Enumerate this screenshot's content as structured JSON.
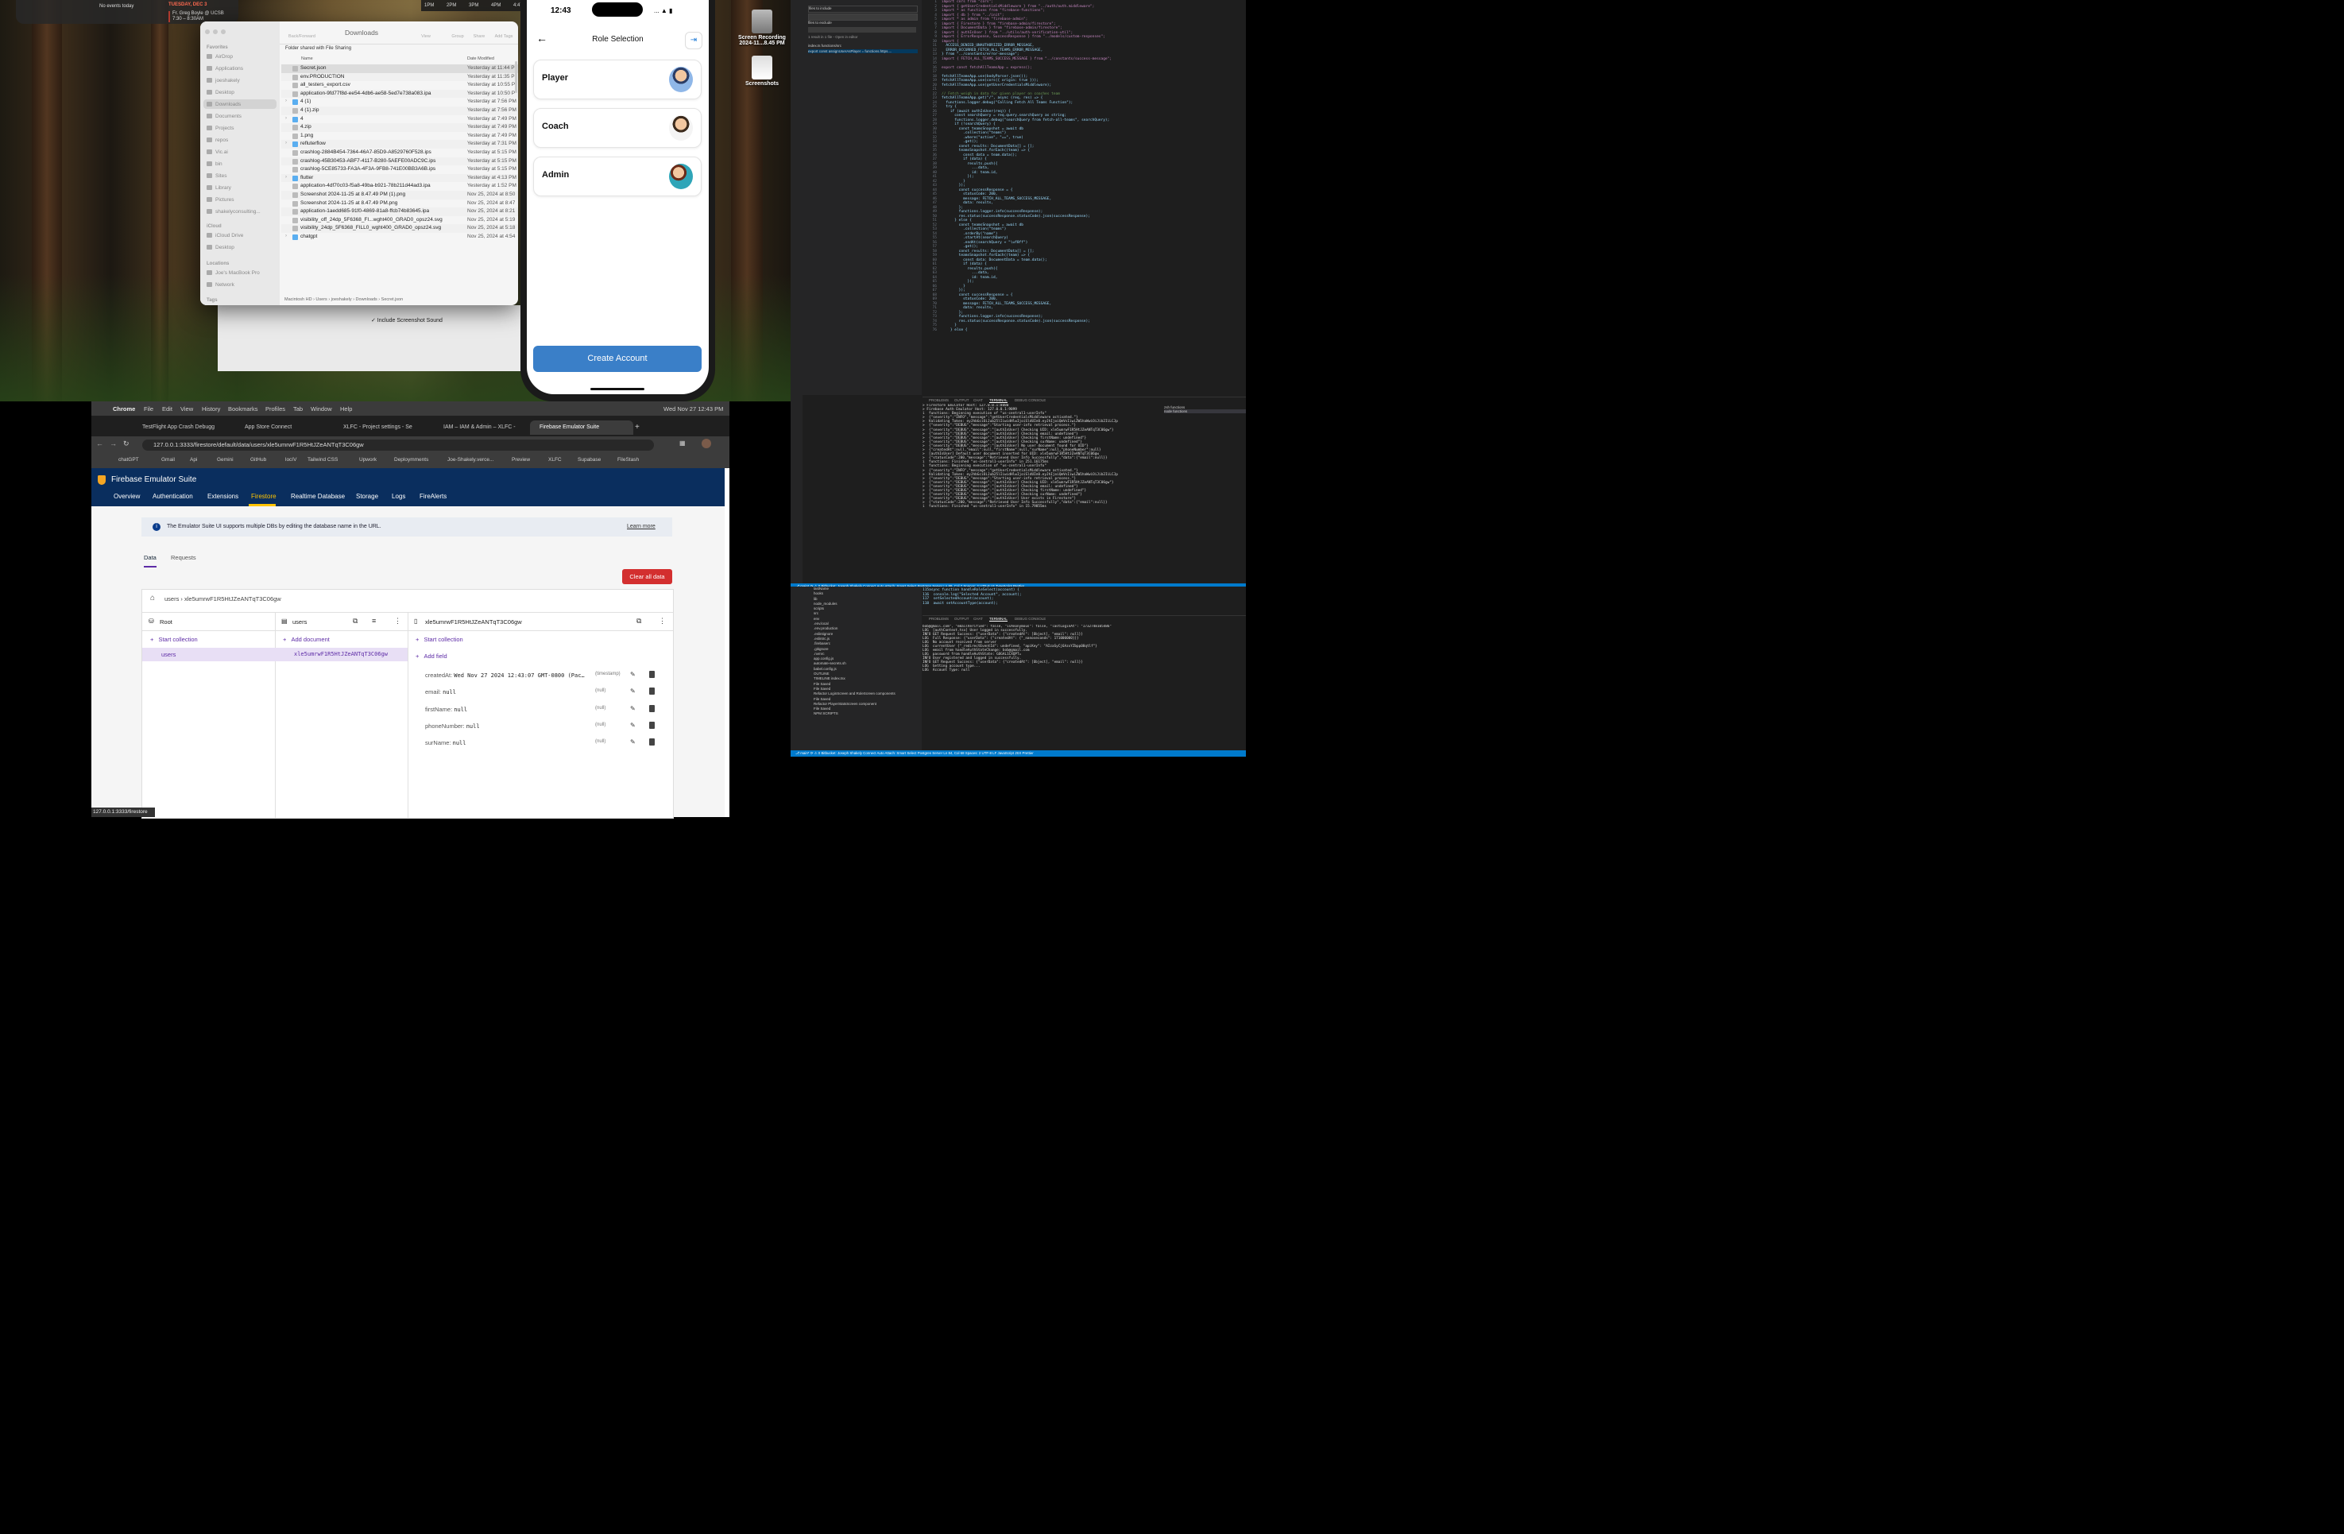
{
  "calendar_widget": {
    "no_events": "No events today",
    "date": "TUESDAY, DEC 3",
    "event_title": "Fr. Greg Boyle @ UCSB",
    "event_time": "7:30 – 8:30AM"
  },
  "timeline": {
    "labels": [
      "1PM",
      "2PM",
      "3PM",
      "4PM",
      "4:47"
    ]
  },
  "finder": {
    "title": "Downloads",
    "toolbar": {
      "back": "Back/Forward",
      "view": "View",
      "group": "Group",
      "share": "Share",
      "add_tags": "Add Tags"
    },
    "sidebar": {
      "favorites_header": "Favorites",
      "favorites": [
        "AirDrop",
        "Applications",
        "joeshakely",
        "Desktop",
        "Downloads",
        "Documents",
        "Projects",
        "repos",
        "Vic.ai",
        "bin",
        "Sites",
        "Library",
        "Pictures",
        "shakelyconsulting..."
      ],
      "icloud_header": "iCloud",
      "icloud": [
        "iCloud Drive",
        "Desktop"
      ],
      "locations_header": "Locations",
      "locations": [
        "Joe's MacBook Pro",
        "Network"
      ],
      "tags_header": "Tags"
    },
    "shared_label": "Folder shared with File Sharing",
    "columns": {
      "name": "Name",
      "modified": "Date Modified"
    },
    "files": [
      {
        "name": "Secret.json",
        "date": "Yesterday at 11:44 P"
      },
      {
        "name": "env.PRODUCTION",
        "date": "Yesterday at 11:35 P"
      },
      {
        "name": "all_testers_export.csv",
        "date": "Yesterday at 10:55 P"
      },
      {
        "name": "application-9fd77f8d-ee54-4db6-ae58-5ed7e738a083.ipa",
        "date": "Yesterday at 10:50 P"
      },
      {
        "name": "4 (1)",
        "date": "Yesterday at 7:56 PM"
      },
      {
        "name": "4 (1).zip",
        "date": "Yesterday at 7:56 PM"
      },
      {
        "name": "4",
        "date": "Yesterday at 7:49 PM"
      },
      {
        "name": "4.zip",
        "date": "Yesterday at 7:49 PM"
      },
      {
        "name": "1.png",
        "date": "Yesterday at 7:49 PM"
      },
      {
        "name": "refluterflow",
        "date": "Yesterday at 7:31 PM"
      },
      {
        "name": "crashlog-2884B454-7364-46A7-85D9-A8529760F528.ips",
        "date": "Yesterday at 5:15 PM"
      },
      {
        "name": "crashlog-45B30453-ABF7-4117-B280-5AEFE00ADC9C.ips",
        "date": "Yesterday at 5:15 PM"
      },
      {
        "name": "crashlog-5CE85733-FA3A-4F3A-9FB8-741E00BB3A6B.ips",
        "date": "Yesterday at 5:15 PM"
      },
      {
        "name": "flutter",
        "date": "Yesterday at 4:13 PM"
      },
      {
        "name": "application-4df70c03-f5a8-49ba-b921-78b211d44ad3.ipa",
        "date": "Yesterday at 1:52 PM"
      },
      {
        "name": "Screenshot 2024-11-25 at 8.47.49 PM (1).png",
        "date": "Nov 25, 2024 at 8:50"
      },
      {
        "name": "Screenshot 2024-11-25 at 8.47.49 PM.png",
        "date": "Nov 25, 2024 at 8:47"
      },
      {
        "name": "application-1aedd685-91f0-4869-81a8-ffcb74b83645.ipa",
        "date": "Nov 25, 2024 at 8:21"
      },
      {
        "name": "visibility_off_24dp_5F6368_FI...wght400_GRAD0_opsz24.svg",
        "date": "Nov 25, 2024 at 5:19"
      },
      {
        "name": "visibility_24dp_5F6368_FILL0_wght400_GRAD0_opsz24.svg",
        "date": "Nov 25, 2024 at 5:18"
      },
      {
        "name": "chatgpt",
        "date": "Nov 25, 2024 at 4:54"
      }
    ],
    "path": "Macintosh HD › Users › joeshakely › Downloads › Secret.json"
  },
  "screenshot_panel": {
    "checkbox": "✓ Include Screenshot Sound"
  },
  "desktop_icons": {
    "recording": "Screen Recording 2024-11...8.45 PM",
    "screenshots": "Screenshots"
  },
  "phone": {
    "time": "12:43",
    "status": "... ▲ ▮",
    "title": "Role Selection",
    "roles": [
      "Player",
      "Coach",
      "Admin"
    ],
    "cta": "Create Account"
  },
  "vscode": {
    "search": {
      "include": "files to include",
      "exclude": "files to exclude",
      "result": "1 result in 1 file - Open in editor",
      "file": "index.ts functions/src",
      "match": "export const assignUserAsPlayer = functions.https...."
    },
    "code_lines": [
      "import cors from \"cors\";",
      "import { getUserCredentialsMiddleware } from \"../auth/auth.middleware\";",
      "import * as functions from \"firebase-functions\";",
      "import { db } from \"../init\";",
      "import * as admin from \"firebase-admin\";",
      "import { Firestore } from \"firebase-admin/firestore\";",
      "import { DocumentData } from \"firebase-admin/firestore\";",
      "import { authIsUser } from \"../utils/auth-verification-util\";",
      "import { ErrorResponse, SuccessResponse } from \"../models/custom-responses\";",
      "import {",
      "  ACCESS_DENIED_UNAUTHORIZED_ERROR_MESSAGE,",
      "  ERROR_OCCURRED_FETCH_ALL_TEAMS_ERROR_MESSAGE,",
      "} from \"../constants/error-message\";",
      "import { FETCH_ALL_TEAMS_SUCCESS_MESSAGE } from \"../constants/success-message\";",
      "",
      "export const fetchAllTeamsApp = express();",
      "",
      "fetchAllTeamsApp.use(bodyParser.json());",
      "fetchAllTeamsApp.use(cors({ origin: true }));",
      "fetchAllTeamsApp.use(getUserCredentialsMiddleware);",
      "",
      "// Fetch weigh in data for given player on coaches team",
      "fetchAllTeamsApp.get(\"/\", async (req, res) => {",
      "  functions.logger.debug(\"Calling Fetch All Teams Function\");",
      "  try {",
      "    if (await authIsUser(req)) {",
      "      const searchQuery = req.query.searchQuery as string;",
      "      functions.logger.debug(\"searchQuery from fetch-all-teams\", searchQuery);",
      "      if (!searchQuery) {",
      "        const teamsSnapshot = await db",
      "          .collection(\"teams\")",
      "          .where(\"active\", \"==\", true)",
      "          .get();",
      "        const results: DocumentData[] = [];",
      "        teamsSnapshot.forEach((team) => {",
      "          const data = team.data();",
      "          if (data) {",
      "            results.push({",
      "              ...data,",
      "              id: team.id,",
      "            });",
      "          }",
      "        });",
      "        const successResponse = {",
      "          statusCode: 200,",
      "          message: FETCH_ALL_TEAMS_SUCCESS_MESSAGE,",
      "          data: results,",
      "        };",
      "        functions.logger.info(successResponse);",
      "        res.status(successResponse.statusCode).json(successResponse);",
      "      } else {",
      "        const teamsSnapshot = await db",
      "          .collection(\"teams\")",
      "          .orderBy(\"name\")",
      "          .startAt(searchQuery)",
      "          .endAt(searchQuery + \"\\uf8ff\")",
      "          .get();",
      "        const results: DocumentData[] = [];",
      "        teamsSnapshot.forEach((team) => {",
      "          const data: DocumentData = team.data();",
      "          if (data) {",
      "            results.push({",
      "              ...data,",
      "              id: team.id,",
      "            });",
      "          }",
      "        });",
      "        const successResponse = {",
      "          statusCode: 200,",
      "          message: FETCH_ALL_TEAMS_SUCCESS_MESSAGE,",
      "          data: results,",
      "        };",
      "        functions.logger.info(successResponse);",
      "        res.status(successResponse.statusCode).json(successResponse);",
      "      }",
      "    } else {"
    ],
    "panel_tabs": [
      "PROBLEMS",
      "OUTPUT",
      "CHAT",
      "TERMINAL",
      "DEBUG CONSOLE"
    ],
    "terminal": "> Firestore Emulator Host: 127.0.0.1:8080\n> Firebase Auth Emulator Host: 127.0.0.1:9099\ni  functions: Beginning execution of \"us-central1-userInfo\"\n>  {\"severity\":\"INFO\",\"message\":\"getUserCredentialsMiddleware activated.\"}\n>  Validating Token: eyJhbGciOiJub25lIiwidHlwIjoiSldUIn0.eyJhIjoiQmVsIiwiZW1haWwiOiJib2IiLCJp\n>  {\"severity\":\"DEBUG\",\"message\":\"Starting user-info retrieval process.\"}\n>  {\"severity\":\"DEBUG\",\"message\":\"[authIsUser] Checking UID: xle5umrwF1R5HtJZeANTqT3C06gw\"}\n>  {\"severity\":\"DEBUG\",\"message\":\"[authIsUser] Checking email: undefined\"}\n>  {\"severity\":\"DEBUG\",\"message\":\"[authIsUser] Checking firstName: undefined\"}\n>  {\"severity\":\"DEBUG\",\"message\":\"[authIsUser] Checking surName: undefined\"}\n>  {\"severity\":\"DEBUG\",\"message\":\"[authIsUser] No user document found for UID\"}\n>  {\"createdAt\":null,\"email\":null,\"firstName\":null,\"surName\":null,\"phoneNumber\":null}\n>  [authIsUser] Default user document inserted for UID: xle5umrwF1R5HtJZeANTqT3C06gw\n>  {\"statusCode\":200,\"message\":\"Retrieved User Info Successfully\",\"data\":{\"email\":null}}\ni  functions: Finished \"us-central1-userInfo\" in 251.16175ms\ni  functions: Beginning execution of \"us-central1-userInfo\"\n>  {\"severity\":\"INFO\",\"message\":\"getUserCredentialsMiddleware activated.\"}\n>  Validating Token: eyJhbGciOiJub25lIiwidHlwIjoiSldUIn0.eyJhIjoiQmVsIiwiZW1haWwiOiJib2IiLCJp\n>  {\"severity\":\"DEBUG\",\"message\":\"Starting user-info retrieval process.\"}\n>  {\"severity\":\"DEBUG\",\"message\":\"[authIsUser] Checking UID: xle5umrwF1R5HtJZeANTqT3C06gw\"}\n>  {\"severity\":\"DEBUG\",\"message\":\"[authIsUser] Checking email: undefined\"}\n>  {\"severity\":\"DEBUG\",\"message\":\"[authIsUser] Checking firstName: undefined\"}\n>  {\"severity\":\"DEBUG\",\"message\":\"[authIsUser] Checking surName: undefined\"}\n>  {\"severity\":\"DEBUG\",\"message\":\"[authIsUser] User exists in Firestore\"}\n>  {\"statusCode\":200,\"message\":\"Retrieved User Info Successfully\",\"data\":{\"email\":null}}\ni  functions: Finished \"us-central1-userInfo\" in 15.79855ms",
    "term_list": [
      "zsh functions",
      "node functions"
    ],
    "status": "⎇ main* ⟳  ⚠ 0  Bitbucket: Joseph Shakely   Connect   Auto Attach: Smart   Select Postgres Server   Ln 89, Col 7  Spaces: 2  UTF-8  LF  TypeScript  Prettier"
  },
  "vscode2": {
    "tree": [
      "lastName",
      "hooks",
      "lib",
      "node_modules",
      "scripts",
      "src",
      "env",
      ".env.local",
      ".env.production",
      ".eslintignore",
      ".eslintrc.js",
      ".firebaserc",
      ".gitignore",
      ".nvmrc",
      "app.config.js",
      "automate-secrets.sh",
      "babel.config.js",
      "OUTLINE",
      "TIMELINE index.tsx",
      "File Saved",
      "File Saved",
      "Refactor LoginScreen and RoleScreen components",
      "File Saved",
      "Refactor PlayerStatsScreen component",
      "File Saved",
      "NPM SCRIPTS"
    ],
    "code_lines": [
      "async function handleRoleSelect(account) {",
      "  console.log(\"Selected Account\", account);",
      "  setSelectedAccount(account);",
      "  await setAccountType(account);"
    ],
    "terminal": "bob@gmail.com\", \"emailVerified\": false, \"isAnonymous\": false, \"lastLoginAt\": \"1732748105486\"\nLOG  [authContext.tsx] User logged in successfully.\nINFO GET Request Success: {\"userData\": {\"createdAt\": [Object], \"email\": null}}\nLOG  Full Response: {\"userData\": {\"createdAt\": {\"_nanoseconds\": 171000000}}}\nLOG  No account received from server\nLOG  currentUser {\"_redirectEventId\": undefined, \"apiKey\": \"AIzaSyCj6AzxYZbpp08qtlf\"}\nLOG  email from handleAuthStateChange: bob@gmail.com\nLOG  password from handleAuthState: GOGAL1CXQPT=\nINFO User registered and logged in successfully.\nINFO GET Request Success: {\"userData\": {\"createdAt\": [Object], \"email\": null}}\nLOG  Getting account type...\nLOG  Account Type: null",
    "status": "⎇ main* ⟳  ⚠ 0  Bitbucket: Joseph Shakely   Connect   Auto Attach: Smart   Select Postgres Server   Ln 84, Col 68  Spaces: 2  UTF-8  LF  JavaScript JSX  Prettier"
  },
  "chrome": {
    "menu": [
      "Chrome",
      "File",
      "Edit",
      "View",
      "History",
      "Bookmarks",
      "Profiles",
      "Tab",
      "Window",
      "Help"
    ],
    "menu_clock": "Wed Nov 27  12:43 PM",
    "tabs": [
      "TestFlight App Crash Debugg",
      "App Store Connect",
      "XLFC - Project settings - Se",
      "IAM – IAM & Admin – XLFC -",
      "Firebase Emulator Suite"
    ],
    "url": "127.0.0.1:3333/firestore/default/data/users/xle5umrwF1R5HtJZeANTqT3C06gw",
    "bookmarks": [
      "chatGPT",
      "Gmail",
      "Api",
      "Gemini",
      "GitHub",
      "locIV",
      "Tailwind CSS",
      "Upwork",
      "Deploymments",
      "Joe-Shakely.verce...",
      "Preview",
      "XLFC",
      "Supabase",
      "FileStash"
    ],
    "status_url": "127.0.0.1:3333/firestore"
  },
  "firebase": {
    "title": "Firebase Emulator Suite",
    "nav": [
      "Overview",
      "Authentication",
      "Extensions",
      "Firestore",
      "Realtime Database",
      "Storage",
      "Logs",
      "FireAlerts"
    ],
    "info": "The Emulator Suite UI supports multiple DBs by editing the database name in the URL.",
    "learn_more": "Learn more",
    "subtabs": [
      "Data",
      "Requests"
    ],
    "clear_all": "Clear all data",
    "breadcrumb": "users  ›  xle5umrwF1R5HtJZeANTqT3C06gw",
    "col_root": "Root",
    "col_users": "users",
    "col_doc": "xle5umrwF1R5HtJZeANTqT3C06gw",
    "start_collection": "Start collection",
    "add_document": "Add document",
    "add_field": "Add field",
    "root_item": "users",
    "doc_item": "xle5umrwF1R5HtJZeANTqT3C06gw",
    "fields": [
      {
        "key": "createdAt:",
        "value": "Wed Nov 27 2024 12:43:07 GMT-0800 (Pac…",
        "type": "(timestamp)"
      },
      {
        "key": "email:",
        "value": "null",
        "type": "(null)"
      },
      {
        "key": "firstName:",
        "value": "null",
        "type": "(null)"
      },
      {
        "key": "phoneNumber:",
        "value": "null",
        "type": "(null)"
      },
      {
        "key": "surName:",
        "value": "null",
        "type": "(null)"
      }
    ]
  }
}
